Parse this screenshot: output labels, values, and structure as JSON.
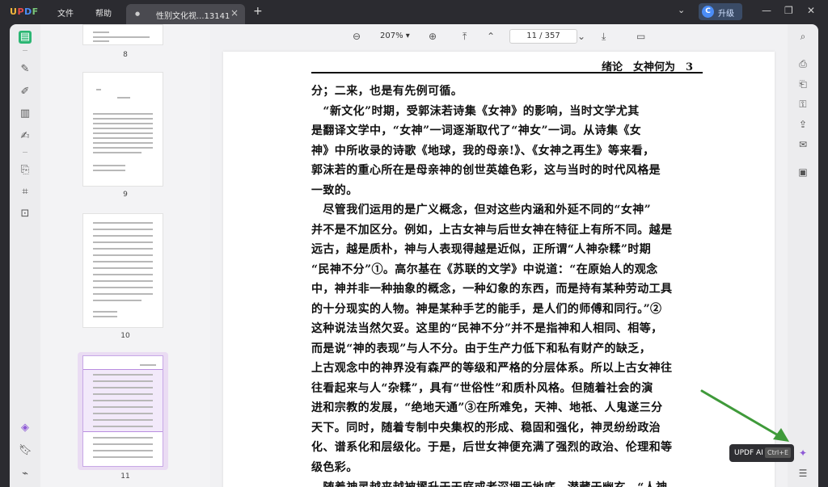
{
  "app": {
    "logo": "UPDF",
    "menu": [
      "文件",
      "帮助"
    ],
    "tab_title": "性别文化视...13141",
    "upgrade_label": "升级",
    "avatar_letter": "C"
  },
  "toolbar": {
    "zoom": "207%",
    "page_current": "11",
    "page_total": "357",
    "page_display": "11 / 357"
  },
  "thumbnails": [
    {
      "page": "8"
    },
    {
      "page": "9"
    },
    {
      "page": "10"
    },
    {
      "page": "11",
      "selected": true
    }
  ],
  "page": {
    "header": "绪论　女神何为　3",
    "lines": [
      "分；二来，也是有先例可循。",
      "　“新文化”时期，受郭沫若诗集《女神》的影响，当时文学尤其",
      "是翻译文学中，“女神”一词逐渐取代了“神女”一词。从诗集《女",
      "神》中所收录的诗歌《地球，我的母亲!》、《女神之再生》等来看，",
      "郭沫若的重心所在是母亲神的创世英雄色彩，这与当时的时代风格是",
      "一致的。",
      "　尽管我们运用的是广义概念，但对这些内涵和外延不同的“女神”",
      "并不是不加区分。例如，上古女神与后世女神在特征上有所不同。越是",
      "远古，越是质朴，神与人表现得越是近似，正所谓“人神杂糅”时期",
      "“民神不分”①。高尔基在《苏联的文学》中说道：“在原始人的观念",
      "中，神并非一种抽象的概念，一种幻象的东西，而是持有某种劳动工具",
      "的十分现实的人物。神是某种手艺的能手，是人们的师傅和同行。”②",
      "这种说法当然欠妥。这里的“民神不分”并不是指神和人相同、相等，",
      "而是说“神的表现”与人不分。由于生产力低下和私有财产的缺乏，",
      "上古观念中的神界没有森严的等级和严格的分层体系。所以上古女神往",
      "往看起来与人“杂糅”，具有“世俗性”和质朴风格。但随着社会的演",
      "进和宗教的发展，“绝地天通”③在所难免，天神、地祇、人鬼遂三分",
      "天下。同时，随着专制中央集权的形成、稳固和强化，神灵纷纷政治",
      "化、谱系化和层级化。于是，后世女神便充满了强烈的政治、伦理和等",
      "级色彩。",
      "　随着神灵越来越被擢升于天庭或者深埋于地底、潜藏于幽玄，“人神"
    ]
  },
  "tooltip": {
    "label": "UPDF AI",
    "shortcut": "Ctrl+E"
  },
  "colors": {
    "accent": "#8e5ad6",
    "annotation_arrow": "#3f9a3a"
  },
  "icons": {
    "left_rail": [
      "reader-icon",
      "comment-icon",
      "edit-icon",
      "page-organize-icon",
      "form-icon",
      "convert-icon",
      "crop-icon",
      "ocr-icon",
      "layers-icon",
      "bookmark-icon",
      "attachment-icon"
    ],
    "right_rail": [
      "search-icon",
      "print-icon",
      "save-as-icon",
      "protect-icon",
      "share-icon",
      "email-icon",
      "save-icon",
      "updf-ai-icon",
      "chat-icon"
    ]
  }
}
